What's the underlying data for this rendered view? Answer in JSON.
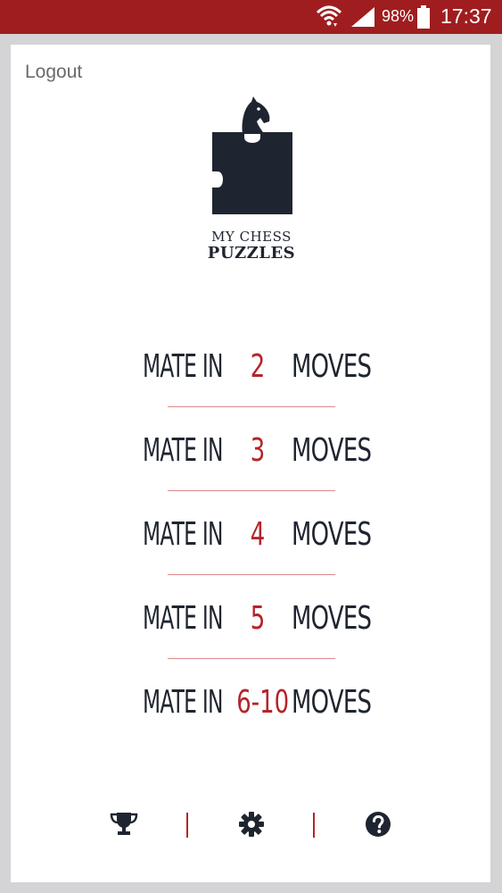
{
  "status_bar": {
    "battery_percent": "98%",
    "time": "17:37",
    "icons": [
      "wifi-icon",
      "signal-icon",
      "battery-icon"
    ]
  },
  "header": {
    "logout_label": "Logout"
  },
  "logo": {
    "line1": "MY CHESS",
    "line2": "PUZZLES"
  },
  "menu": {
    "items": [
      {
        "prefix": "MATE IN",
        "number": "2",
        "suffix": "MOVES"
      },
      {
        "prefix": "MATE IN",
        "number": "3",
        "suffix": "MOVES"
      },
      {
        "prefix": "MATE IN",
        "number": "4",
        "suffix": "MOVES"
      },
      {
        "prefix": "MATE IN",
        "number": "5",
        "suffix": "MOVES"
      },
      {
        "prefix": "MATE IN",
        "number": "6-10",
        "suffix": "MOVES"
      }
    ]
  },
  "bottom_bar": {
    "icons": [
      "trophy-icon",
      "gear-icon",
      "help-icon"
    ]
  },
  "colors": {
    "status_bar": "#a01d1f",
    "accent": "#b4242a",
    "text_dark": "#1f2530",
    "background": "#d4d4d6"
  }
}
